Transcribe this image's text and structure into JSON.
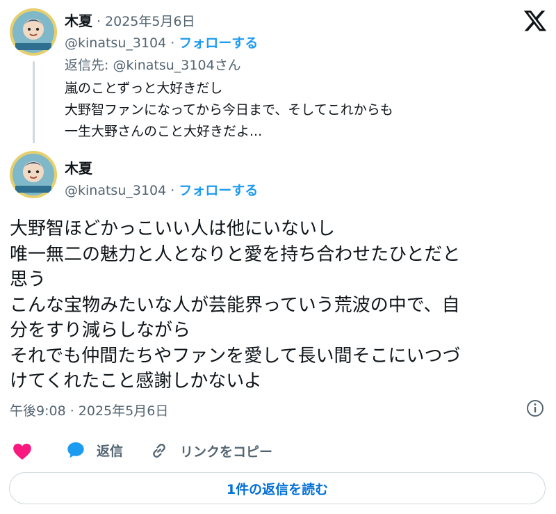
{
  "parent": {
    "author_name": "木夏",
    "separator": "·",
    "date": "2025年5月6日",
    "handle": "@kinatsu_3104",
    "follow_label": "フォローする",
    "reply_to": "返信先: @kinatsu_3104さん",
    "lines": [
      "嵐のことずっと大好きだし",
      "大野智ファンになってから今日まで、そしてこれからも",
      "一生大野さんのこと大好きだよ..."
    ]
  },
  "main": {
    "author_name": "木夏",
    "handle": "@kinatsu_3104",
    "follow_label": "フォローする",
    "lines": [
      "大野智ほどかっこいい人は他にいないし",
      "唯一無二の魅力と人となりと愛を持ち合わせたひとだと",
      "思う",
      "こんな宝物みたいな人が芸能界っていう荒波の中で、自",
      "分をすり減らしながら",
      "それでも仲間たちやファンを愛して長い間そこにいつづ",
      "けてくれたこと感謝しかないよ"
    ],
    "timestamp": "午後9:08 · 2025年5月6日"
  },
  "actions": {
    "reply_label": "返信",
    "copy_link_label": "リンクをコピー"
  },
  "read_replies_label": "1件の返信を読む",
  "colors": {
    "accent": "#1d9bf0",
    "like": "#f91880",
    "muted": "#536471",
    "border": "#cfd9de"
  }
}
